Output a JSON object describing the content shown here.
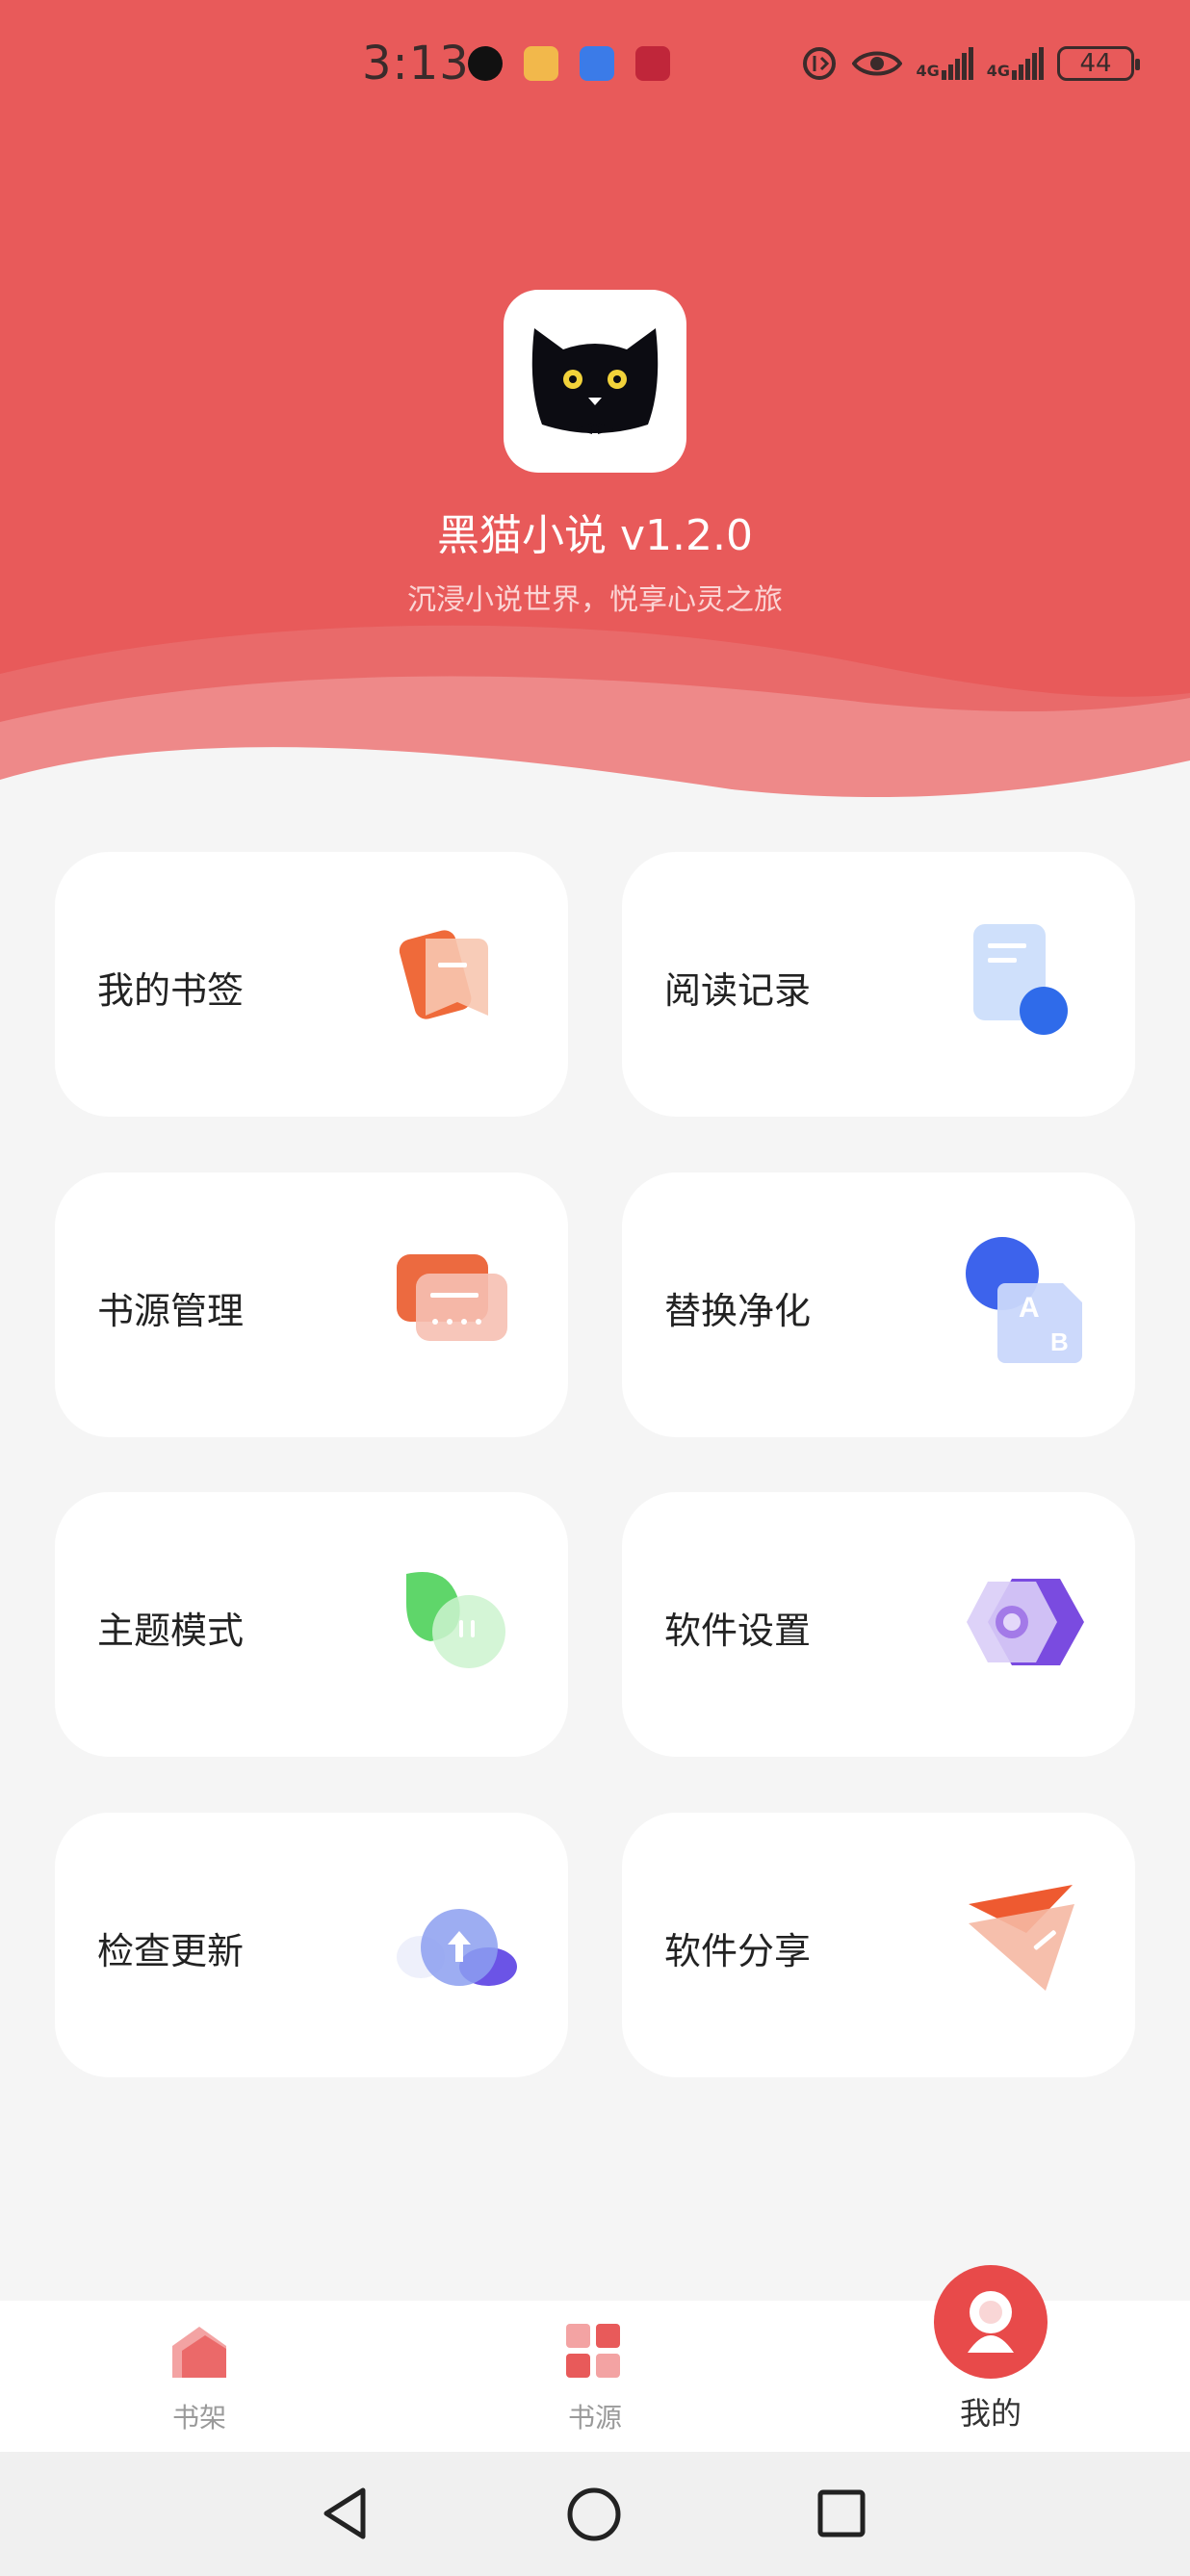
{
  "status_bar": {
    "time": "3:13",
    "signal_1": "4G",
    "signal_2": "4G",
    "battery": "44"
  },
  "app": {
    "name": "黑猫小说 v1.2.0",
    "tagline": "沉浸小说世界，悦享心灵之旅",
    "logo_icon": "black-cat-logo"
  },
  "menu": [
    {
      "label": "我的书签",
      "icon": "bookmark-icon"
    },
    {
      "label": "阅读记录",
      "icon": "reading-history-icon"
    },
    {
      "label": "书源管理",
      "icon": "book-source-icon"
    },
    {
      "label": "替换净化",
      "icon": "replace-icon"
    },
    {
      "label": "主题模式",
      "icon": "theme-icon"
    },
    {
      "label": "软件设置",
      "icon": "settings-icon"
    },
    {
      "label": "检查更新",
      "icon": "update-icon"
    },
    {
      "label": "软件分享",
      "icon": "share-icon"
    }
  ],
  "tabs": [
    {
      "label": "书架",
      "icon": "bookshelf-icon"
    },
    {
      "label": "书源",
      "icon": "source-icon"
    },
    {
      "label": "我的",
      "icon": "profile-icon",
      "active": true
    }
  ],
  "colors": {
    "primary": "#e85a5a",
    "background": "#f5f5f5"
  }
}
